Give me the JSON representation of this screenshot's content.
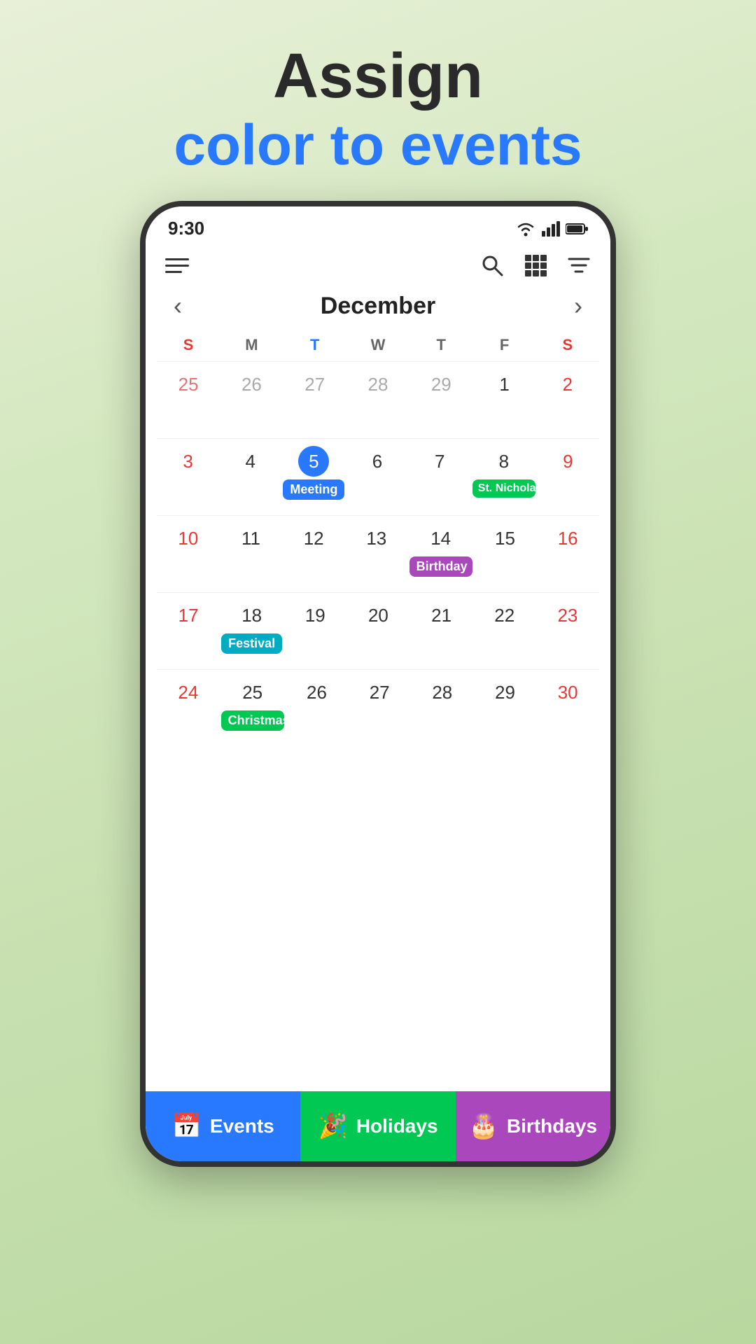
{
  "header": {
    "line1": "Assign",
    "line2": "color to events"
  },
  "statusBar": {
    "time": "9:30"
  },
  "toolbar": {
    "searchLabel": "search",
    "gridLabel": "grid-view",
    "filterLabel": "filter"
  },
  "calendar": {
    "month": "December",
    "prevArrow": "‹",
    "nextArrow": "›",
    "dayHeaders": [
      {
        "label": "S",
        "type": "sun"
      },
      {
        "label": "M",
        "type": "regular"
      },
      {
        "label": "T",
        "type": "tue-highlight"
      },
      {
        "label": "W",
        "type": "regular"
      },
      {
        "label": "T",
        "type": "regular"
      },
      {
        "label": "F",
        "type": "regular"
      },
      {
        "label": "S",
        "type": "sat"
      }
    ],
    "weeks": [
      [
        {
          "day": "25",
          "type": "outside sunday"
        },
        {
          "day": "26",
          "type": "outside"
        },
        {
          "day": "27",
          "type": "outside"
        },
        {
          "day": "28",
          "type": "outside"
        },
        {
          "day": "29",
          "type": "outside"
        },
        {
          "day": "1",
          "type": "normal",
          "event": null
        },
        {
          "day": "2",
          "type": "saturday"
        }
      ],
      [
        {
          "day": "3",
          "type": "sunday"
        },
        {
          "day": "4",
          "type": "normal"
        },
        {
          "day": "5",
          "type": "today",
          "event": {
            "label": "Meeting",
            "color": "blue"
          }
        },
        {
          "day": "6",
          "type": "normal"
        },
        {
          "day": "7",
          "type": "normal",
          "event": null
        },
        {
          "day": "8",
          "type": "normal",
          "event": {
            "label": "St. Nicholas Day",
            "color": "green"
          }
        },
        {
          "day": "9",
          "type": "saturday"
        }
      ],
      [
        {
          "day": "10",
          "type": "sunday"
        },
        {
          "day": "11",
          "type": "normal"
        },
        {
          "day": "12",
          "type": "normal"
        },
        {
          "day": "13",
          "type": "normal"
        },
        {
          "day": "14",
          "type": "normal",
          "event": {
            "label": "Birthday",
            "color": "purple"
          }
        },
        {
          "day": "15",
          "type": "normal"
        },
        {
          "day": "16",
          "type": "saturday"
        }
      ],
      [
        {
          "day": "17",
          "type": "sunday"
        },
        {
          "day": "18",
          "type": "normal",
          "event": {
            "label": "Festival",
            "color": "teal"
          }
        },
        {
          "day": "19",
          "type": "normal"
        },
        {
          "day": "20",
          "type": "normal"
        },
        {
          "day": "21",
          "type": "normal"
        },
        {
          "day": "22",
          "type": "normal"
        },
        {
          "day": "23",
          "type": "saturday"
        }
      ],
      [
        {
          "day": "24",
          "type": "sunday"
        },
        {
          "day": "25",
          "type": "normal",
          "event": {
            "label": "Christmas",
            "color": "green"
          }
        },
        {
          "day": "26",
          "type": "normal"
        },
        {
          "day": "27",
          "type": "normal"
        },
        {
          "day": "28",
          "type": "normal"
        },
        {
          "day": "29",
          "type": "normal"
        },
        {
          "day": "30",
          "type": "saturday"
        }
      ]
    ]
  },
  "bottomTabs": [
    {
      "label": "Events",
      "icon": "📅",
      "color": "events"
    },
    {
      "label": "Holidays",
      "icon": "🎉",
      "color": "holidays"
    },
    {
      "label": "Birthdays",
      "icon": "🎂",
      "color": "birthdays"
    }
  ]
}
